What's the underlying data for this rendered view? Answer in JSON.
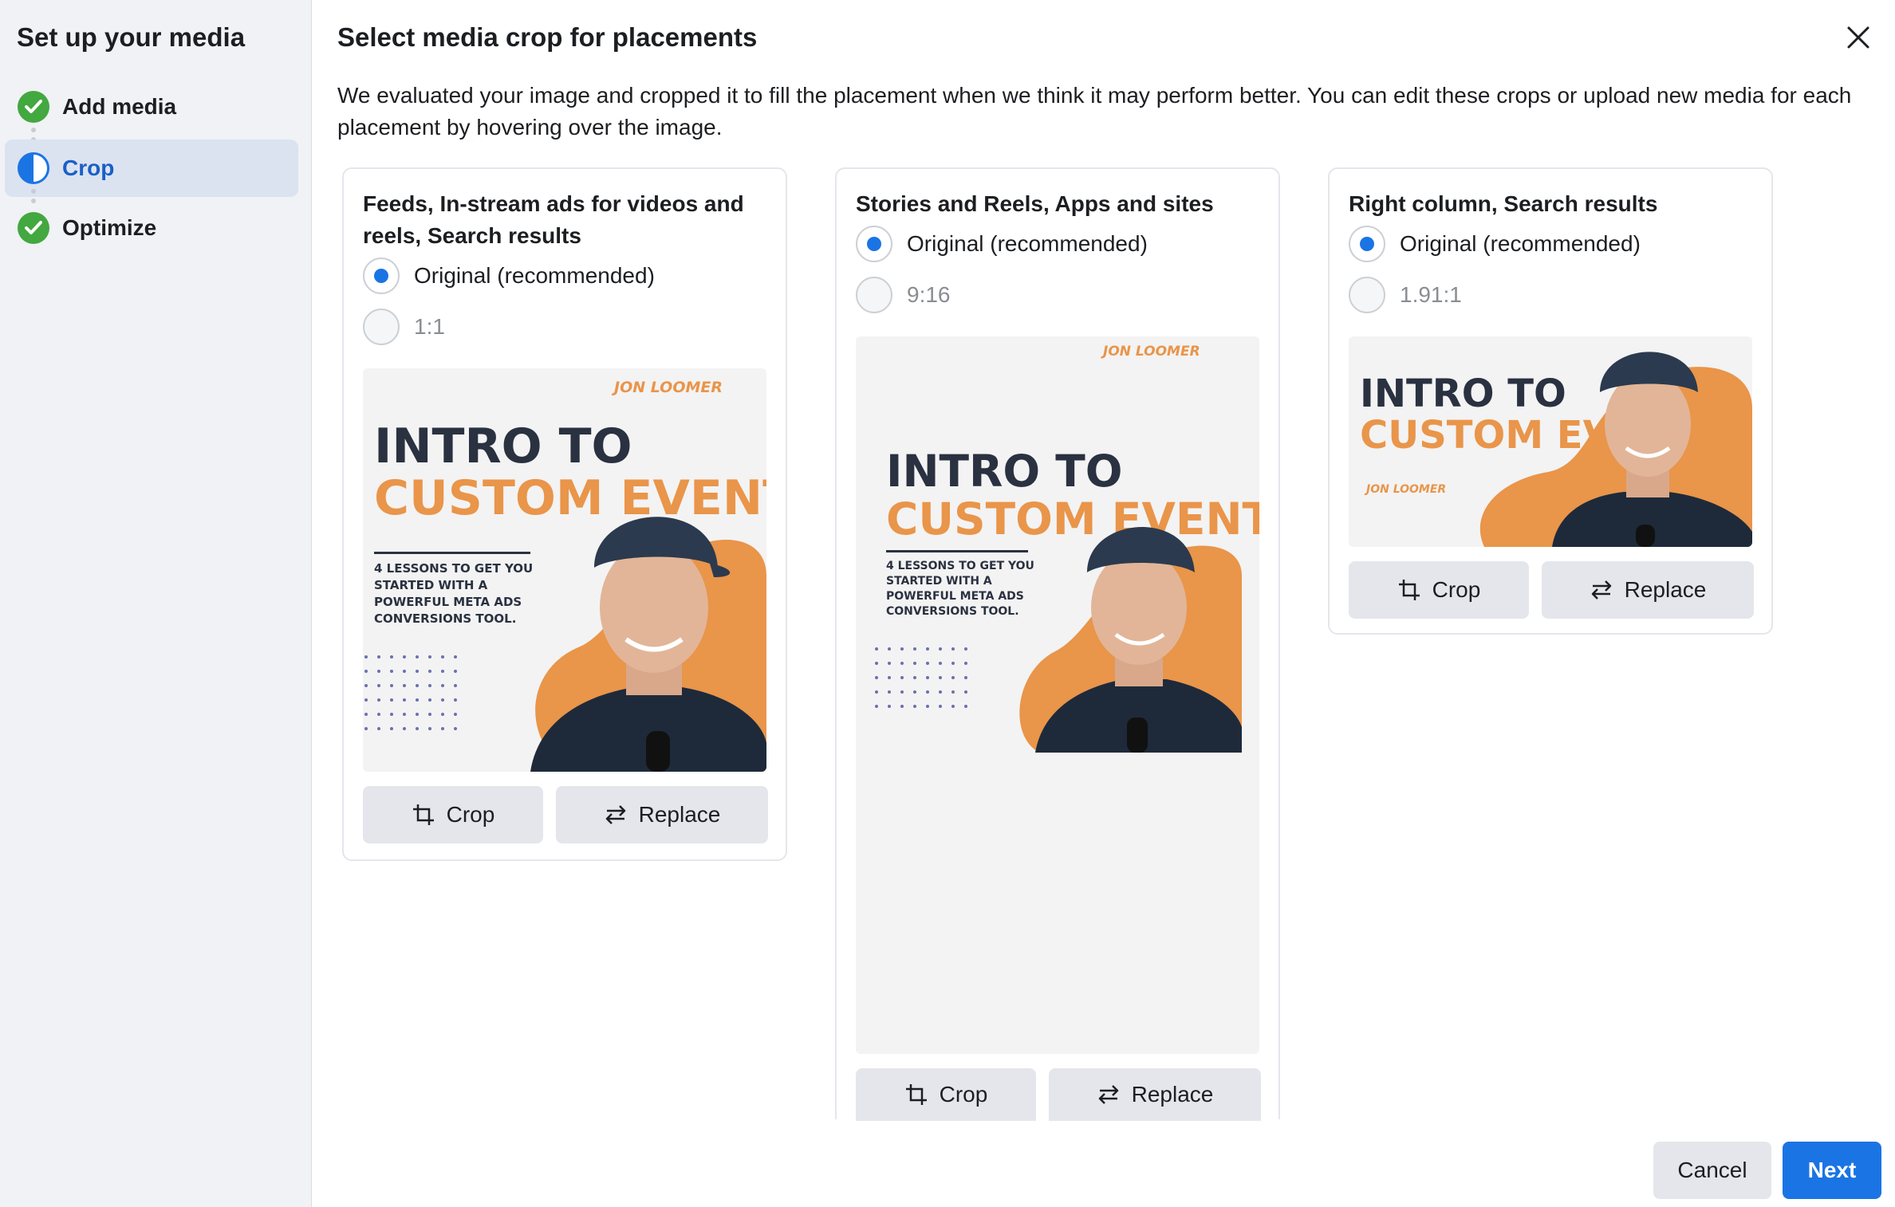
{
  "sidebar": {
    "title": "Set up your media",
    "steps": [
      {
        "label": "Add media",
        "state": "done"
      },
      {
        "label": "Crop",
        "state": "active"
      },
      {
        "label": "Optimize",
        "state": "done"
      }
    ]
  },
  "main": {
    "title": "Select media crop for placements",
    "description": "We evaluated your image and cropped it to fill the placement when we think it may perform better. You can edit these crops or upload new media for each placement by hovering over the image."
  },
  "artwork": {
    "logo": "JON LOOMER",
    "headline_line1": "INTRO TO",
    "headline_line2": "CUSTOM EVENTS",
    "tagline": [
      "4 LESSONS TO GET YOU",
      "STARTED WITH A",
      "POWERFUL META ADS",
      "CONVERSIONS TOOL."
    ]
  },
  "cards": [
    {
      "title": "Feeds, In-stream ads for videos and reels, Search results",
      "option_original": "Original (recommended)",
      "option_crop": "1:1",
      "crop_label": "Crop",
      "replace_label": "Replace"
    },
    {
      "title": "Stories and Reels, Apps and sites",
      "option_original": "Original (recommended)",
      "option_crop": "9:16",
      "crop_label": "Crop",
      "replace_label": "Replace"
    },
    {
      "title": "Right column, Search results",
      "option_original": "Original (recommended)",
      "option_crop": "1.91:1",
      "crop_label": "Crop",
      "replace_label": "Replace"
    }
  ],
  "footer": {
    "cancel_label": "Cancel",
    "next_label": "Next"
  },
  "colors": {
    "accent": "#1b74e4",
    "success": "#42a83f",
    "orange": "#e9954a",
    "navy": "#1e2a3a"
  }
}
